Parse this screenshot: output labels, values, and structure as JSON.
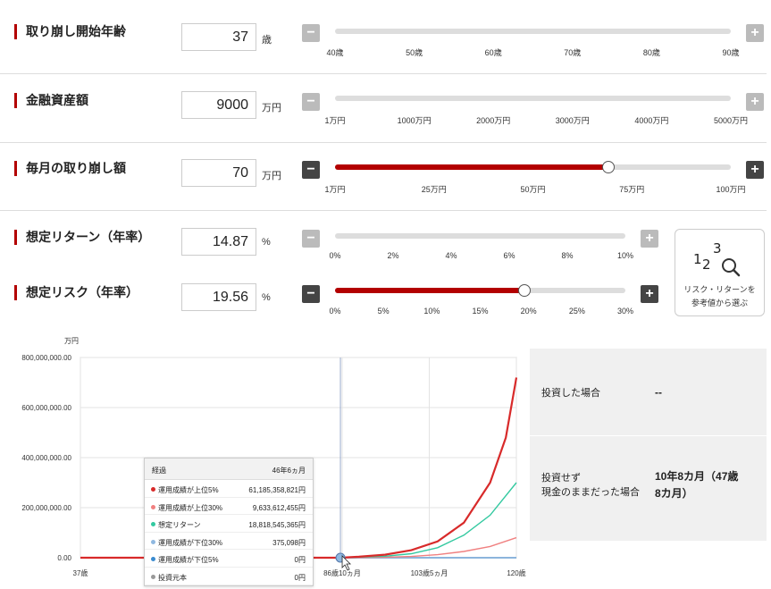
{
  "inputs": {
    "start_age": {
      "label": "取り崩し開始年齢",
      "value": "37",
      "unit": "歳",
      "ticks": [
        "40歳",
        "50歳",
        "60歳",
        "70歳",
        "80歳",
        "90歳"
      ],
      "slider_fraction": 0
    },
    "assets": {
      "label": "金融資産額",
      "value": "9000",
      "unit": "万円",
      "ticks": [
        "1万円",
        "1000万円",
        "2000万円",
        "3000万円",
        "4000万円",
        "5000万円"
      ],
      "slider_fraction": 0
    },
    "monthly": {
      "label": "毎月の取り崩し額",
      "value": "70",
      "unit": "万円",
      "ticks": [
        "1万円",
        "25万円",
        "50万円",
        "75万円",
        "100万円"
      ],
      "slider_fraction": 0.69
    },
    "return": {
      "label": "想定リターン（年率）",
      "value": "14.87",
      "unit": "%",
      "ticks": [
        "0%",
        "2%",
        "4%",
        "6%",
        "8%",
        "10%"
      ],
      "slider_fraction": 0
    },
    "risk": {
      "label": "想定リスク（年率）",
      "value": "19.56",
      "unit": "%",
      "ticks": [
        "0%",
        "5%",
        "10%",
        "15%",
        "20%",
        "25%",
        "30%"
      ],
      "slider_fraction": 0.652
    }
  },
  "buttons": {
    "minus": "−",
    "plus": "+"
  },
  "reference": {
    "digits": "123",
    "label_line1": "リスク・リターンを",
    "label_line2": "参考値から選ぶ",
    "icon": "magnifier-icon"
  },
  "colors": {
    "accent": "#b30000",
    "top5": "#d82a2a",
    "top30": "#f08080",
    "expected": "#33c9a0",
    "low30": "#8fb8e0",
    "low5": "#3a8bd0",
    "principal": "#999999"
  },
  "chart_data": {
    "type": "line",
    "ylabel": "万円",
    "y_ticks": [
      "800,000,000.00",
      "600,000,000.00",
      "400,000,000.00",
      "200,000,000.00",
      "0.00"
    ],
    "ylim": [
      0,
      800000000
    ],
    "x_ticks": [
      "37歳",
      "86歳10ヵ月",
      "103歳5ヵ月",
      "120歳"
    ],
    "x_tick_ages": [
      37,
      86.83,
      103.42,
      120
    ],
    "xlim": [
      37,
      120
    ],
    "series": [
      {
        "name": "運用成績が上位5%",
        "x": [
          37,
          70,
          86.5,
          90,
          95,
          100,
          105,
          110,
          115,
          118,
          120
        ],
        "values": [
          0,
          0,
          0,
          4000000,
          12000000,
          30000000,
          65000000,
          140000000,
          300000000,
          480000000,
          720000000
        ]
      },
      {
        "name": "運用成績が上位30%",
        "x": [
          37,
          86.5,
          95,
          100,
          105,
          110,
          115,
          120
        ],
        "values": [
          0,
          0,
          2000000,
          5000000,
          12000000,
          25000000,
          45000000,
          80000000
        ]
      },
      {
        "name": "想定リターン",
        "x": [
          37,
          86.5,
          95,
          100,
          105,
          110,
          115,
          120
        ],
        "values": [
          0,
          0,
          6000000,
          16000000,
          40000000,
          90000000,
          170000000,
          300000000
        ]
      },
      {
        "name": "運用成績が下位30%",
        "x": [
          37,
          120
        ],
        "values": [
          0,
          0
        ]
      },
      {
        "name": "運用成績が下位5%",
        "x": [
          37,
          120
        ],
        "values": [
          0,
          0
        ]
      },
      {
        "name": "投資元本",
        "x": [
          37,
          120
        ],
        "values": [
          0,
          0
        ]
      }
    ],
    "marker_age": 86.5,
    "tooltip": {
      "header_label": "経過",
      "header_value": "46年6ヵ月",
      "rows": [
        {
          "label": "運用成績が上位5%",
          "value": "61,185,358,821円"
        },
        {
          "label": "運用成績が上位30%",
          "value": "9,633,612,455円"
        },
        {
          "label": "想定リターン",
          "value": "18,818,545,365円"
        },
        {
          "label": "運用成績が下位30%",
          "value": "375,098円"
        },
        {
          "label": "運用成績が下位5%",
          "value": "0円"
        },
        {
          "label": "投資元本",
          "value": "0円"
        }
      ]
    }
  },
  "side_panel": {
    "invested_label": "投資した場合",
    "invested_value": "--",
    "cash_label_line1": "投資せず",
    "cash_label_line2": "現金のままだった場合",
    "cash_value_line1": "10年8カ月（47歳",
    "cash_value_line2": "8カ月）"
  }
}
